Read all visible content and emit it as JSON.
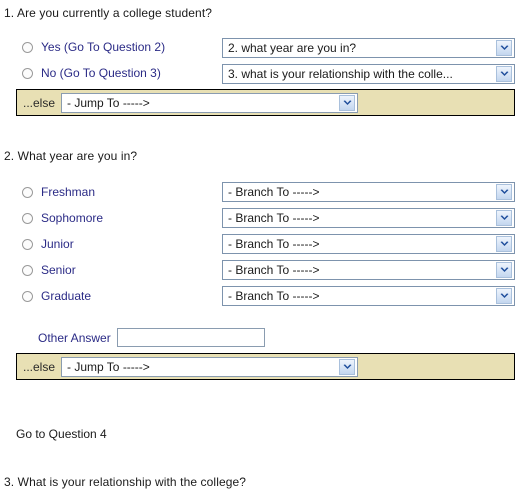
{
  "questions": [
    {
      "heading": "1. Are you currently a college student?",
      "options": [
        {
          "label": "Yes (Go To Question 2)",
          "branch": "2. what year are you in?"
        },
        {
          "label": "No (Go To Question 3)",
          "branch": "3. what is your relationship with the colle..."
        }
      ],
      "else_row": {
        "label": "...else",
        "value": "- Jump To ----->"
      }
    },
    {
      "heading": "2. What year are you in?",
      "options": [
        {
          "label": "Freshman",
          "branch": "- Branch To ----->"
        },
        {
          "label": "Sophomore",
          "branch": "- Branch To ----->"
        },
        {
          "label": "Junior",
          "branch": "- Branch To ----->"
        },
        {
          "label": "Senior",
          "branch": "- Branch To ----->"
        },
        {
          "label": "Graduate",
          "branch": "- Branch To ----->"
        }
      ],
      "other": {
        "label": "Other Answer",
        "value": "",
        "placeholder": ""
      },
      "else_row": {
        "label": "...else",
        "value": "- Jump To ----->"
      },
      "note": "Go to Question 4"
    },
    {
      "heading": "3. What is your relationship with the college?"
    }
  ],
  "icons": {
    "dropdown": "chevron-down-icon"
  },
  "colors": {
    "else_bar_background": "#e8e0b4",
    "else_bar_border": "#000000",
    "option_label": "#2b2b86",
    "select_border": "#7d93ad",
    "arrow_fill": "#1f4e9c"
  }
}
